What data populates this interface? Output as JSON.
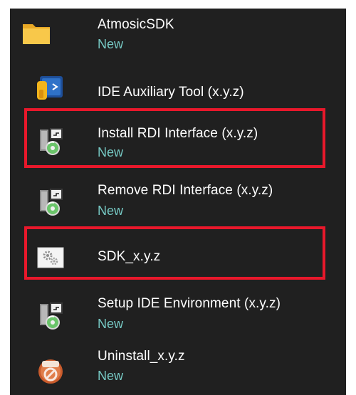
{
  "start_menu": {
    "group": {
      "label": "AtmosicSDK",
      "badge": "New",
      "icon": "folder-icon"
    },
    "items": [
      {
        "label": "IDE Auxiliary Tool (x.y.z)",
        "badge": "",
        "icon": "ide-tool-icon"
      },
      {
        "label": "Install RDI Interface (x.y.z)",
        "badge": "New",
        "icon": "installer-icon"
      },
      {
        "label": "Remove RDI Interface (x.y.z)",
        "badge": "New",
        "icon": "installer-icon"
      },
      {
        "label": "SDK_x.y.z",
        "badge": "",
        "icon": "gears-shortcut-icon"
      },
      {
        "label": "Setup IDE Environment (x.y.z)",
        "badge": "New",
        "icon": "installer-icon"
      },
      {
        "label": "Uninstall_x.y.z",
        "badge": "New",
        "icon": "uninstall-icon"
      }
    ]
  },
  "colors": {
    "background": "#202020",
    "text": "#ffffff",
    "new_badge": "#76c9c4",
    "highlight": "#e8182b"
  }
}
